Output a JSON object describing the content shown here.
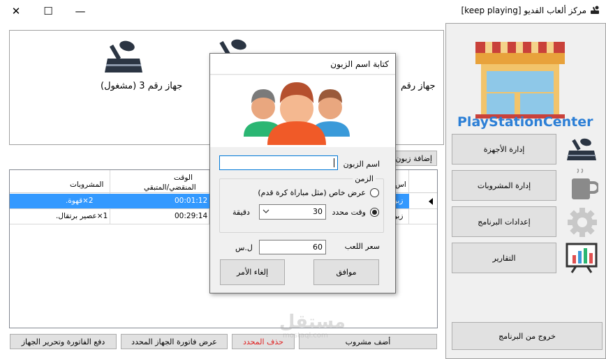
{
  "window": {
    "title": "مركز ألعاب الفديو [keep playing]",
    "minimize": "—",
    "maximize": "☐",
    "close": "✕"
  },
  "devices": [
    {
      "label": "جهاز رقم 3 (مشغول)"
    },
    {
      "label": "جهاز رقم"
    }
  ],
  "toolbar": {
    "add_customer": "إضافة زبون"
  },
  "grid": {
    "columns": [
      "المشروبات",
      "الوقت المنقضي/المتبقي",
      "اس"
    ],
    "time_header_line1": "الوقت",
    "time_header_line2": "المنقضي/المتبقي",
    "rows": [
      {
        "drinks": "2×قهوة.",
        "time": "00:01:12",
        "name": "زبو"
      },
      {
        "drinks": "1×عصير برتقال.",
        "time": "00:29:14",
        "name": "زبو"
      }
    ]
  },
  "bottom_buttons": {
    "pay_bill": "دفع الفاتورة وتحرير الجهاز",
    "show_bill": "عرض فاتورة الجهاز المحدد",
    "delete_selected": "حذف المحدد",
    "add_drink": "أضف مشروب"
  },
  "sidebar": {
    "brand": "PlayStationCenter",
    "items": [
      {
        "label": "إدارة الأجهزة"
      },
      {
        "label": "إدارة المشروبات"
      },
      {
        "label": "إعدادات البرنامج"
      },
      {
        "label": "التقارير"
      }
    ],
    "exit": "خروج من البرنامج"
  },
  "dialog": {
    "title": "كتابة اسم الزبون",
    "customer_name_label": "اسم الزبون",
    "customer_name_value": "",
    "time_group_label": "الزمن",
    "special_offer_label": "عرض خاص (مثل مباراة كرة قدم)",
    "fixed_time_label": "وقت محدد",
    "minutes_value": "30",
    "minutes_unit": "دقيقة",
    "price_label": "سعر اللعب",
    "price_value": "60",
    "currency": "ل.س",
    "ok": "موافق",
    "cancel": "إلغاء الأمر",
    "selected_option": "fixed_time"
  },
  "watermark": {
    "text": "مستقل",
    "url": "mostaql.com"
  },
  "colors": {
    "selection": "#3399ff",
    "brand": "#2c7fd6",
    "cancel_red": "#e02020"
  }
}
